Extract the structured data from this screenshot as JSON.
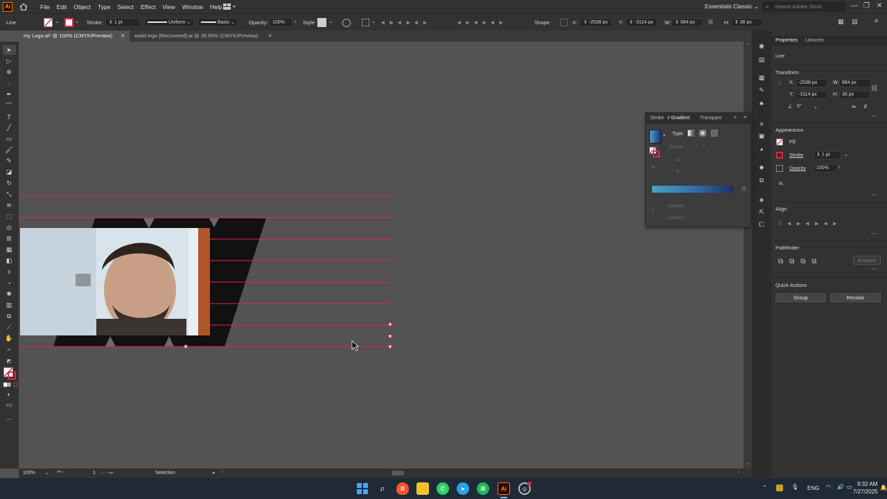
{
  "app": {
    "logo": "Ai"
  },
  "menu": [
    "File",
    "Edit",
    "Object",
    "Type",
    "Select",
    "Effect",
    "View",
    "Window",
    "Help"
  ],
  "workspace": "Essentials Classic",
  "search_placeholder": "Search Adobe Stock",
  "control_bar": {
    "object_type": "Line",
    "stroke_label": "Stroke:",
    "stroke_weight": "1 pt",
    "profile": "Uniform",
    "brush": "Basic",
    "opacity_label": "Opacity:",
    "opacity": "100%",
    "style_label": "Style:",
    "shape_label": "Shape:",
    "x_label": "X:",
    "x": "-2538 px",
    "y_label": "Y:",
    "y": "-3114 px",
    "w_label": "W:",
    "w": "684 px",
    "h_label": "H:",
    "h": "36 px"
  },
  "tabs": [
    {
      "label": "my Logo.ai* @ 100% (CMYK/Preview)",
      "active": true
    },
    {
      "label": "walid logo [Recovered].ai @ 36.56% (CMYK/Preview)",
      "active": false
    }
  ],
  "status": {
    "zoom": "100%",
    "artboard": "1",
    "tool": "Selection"
  },
  "properties": {
    "tabs": [
      "Properties",
      "Libraries"
    ],
    "selection": "Line",
    "transform_title": "Transform",
    "x_label": "X:",
    "x": "-2538 px",
    "y_label": "Y:",
    "y": "-3114 px",
    "w_label": "W:",
    "w": "684 px",
    "h_label": "H:",
    "h": "36 px",
    "angle": "0°",
    "appearance_title": "Appearance",
    "fill_label": "Fill",
    "stroke_label": "Stroke",
    "stroke_weight": "1 pt",
    "opacity_label": "Opacity",
    "opacity": "100%",
    "fx_label": "fx.",
    "align_title": "Align",
    "pathfinder_title": "Pathfinder",
    "expand_label": "Expand",
    "quick_actions_title": "Quick Actions",
    "group_button": "Group",
    "recolor_button": "Recolor"
  },
  "gradient_panel": {
    "tabs": [
      "Stroke",
      "Gradient",
      "Transpare"
    ],
    "type_label": "Type:",
    "stroke_label": "Stroke:",
    "opacity_label": "Opacity:",
    "location_label": "Location:"
  },
  "taskbar": {
    "language": "ENG",
    "time": "9:32 AM",
    "date": "7/27/2025"
  },
  "colors": {
    "accent_red": "#e8234a",
    "gradient_start": "#4aa3c8",
    "gradient_end": "#1a2f6a",
    "ui_dark": "#323232",
    "canvas": "#535353"
  }
}
